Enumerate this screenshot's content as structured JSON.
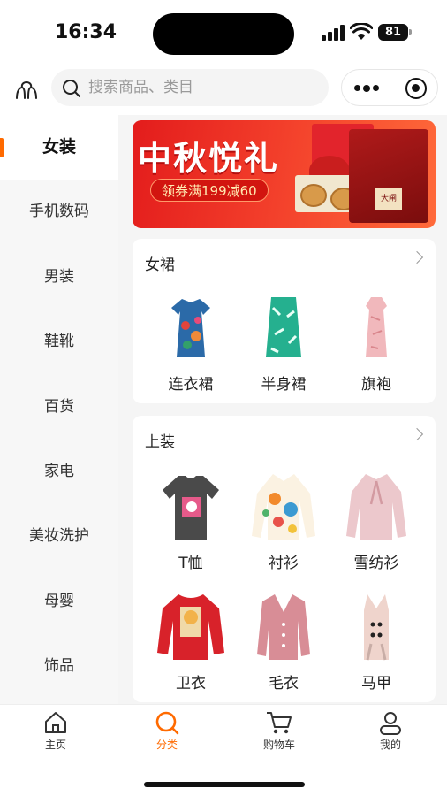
{
  "status": {
    "time": "16:34",
    "battery": "81"
  },
  "search": {
    "placeholder": "搜索商品、类目"
  },
  "sidebar": {
    "items": [
      {
        "label": "女装",
        "active": true
      },
      {
        "label": "手机数码"
      },
      {
        "label": "男装"
      },
      {
        "label": "鞋靴"
      },
      {
        "label": "百货"
      },
      {
        "label": "家电"
      },
      {
        "label": "美妆洗护"
      },
      {
        "label": "母婴"
      },
      {
        "label": "饰品"
      }
    ]
  },
  "banner": {
    "title": "中秋悦礼",
    "coupon": "领券满199减60",
    "box_text": "大闸"
  },
  "sections": [
    {
      "title": "女裙",
      "items": [
        "连衣裙",
        "半身裙",
        "旗袍"
      ]
    },
    {
      "title": "上装",
      "items": [
        "T恤",
        "衬衫",
        "雪纺衫",
        "卫衣",
        "毛衣",
        "马甲"
      ]
    }
  ],
  "tabbar": {
    "items": [
      {
        "label": "主页",
        "icon": "home-icon"
      },
      {
        "label": "分类",
        "icon": "category-search-icon",
        "active": true
      },
      {
        "label": "购物车",
        "icon": "cart-icon"
      },
      {
        "label": "我的",
        "icon": "profile-icon"
      }
    ]
  },
  "colors": {
    "accent": "#ff6a00",
    "banner_red": "#e31c1c"
  }
}
